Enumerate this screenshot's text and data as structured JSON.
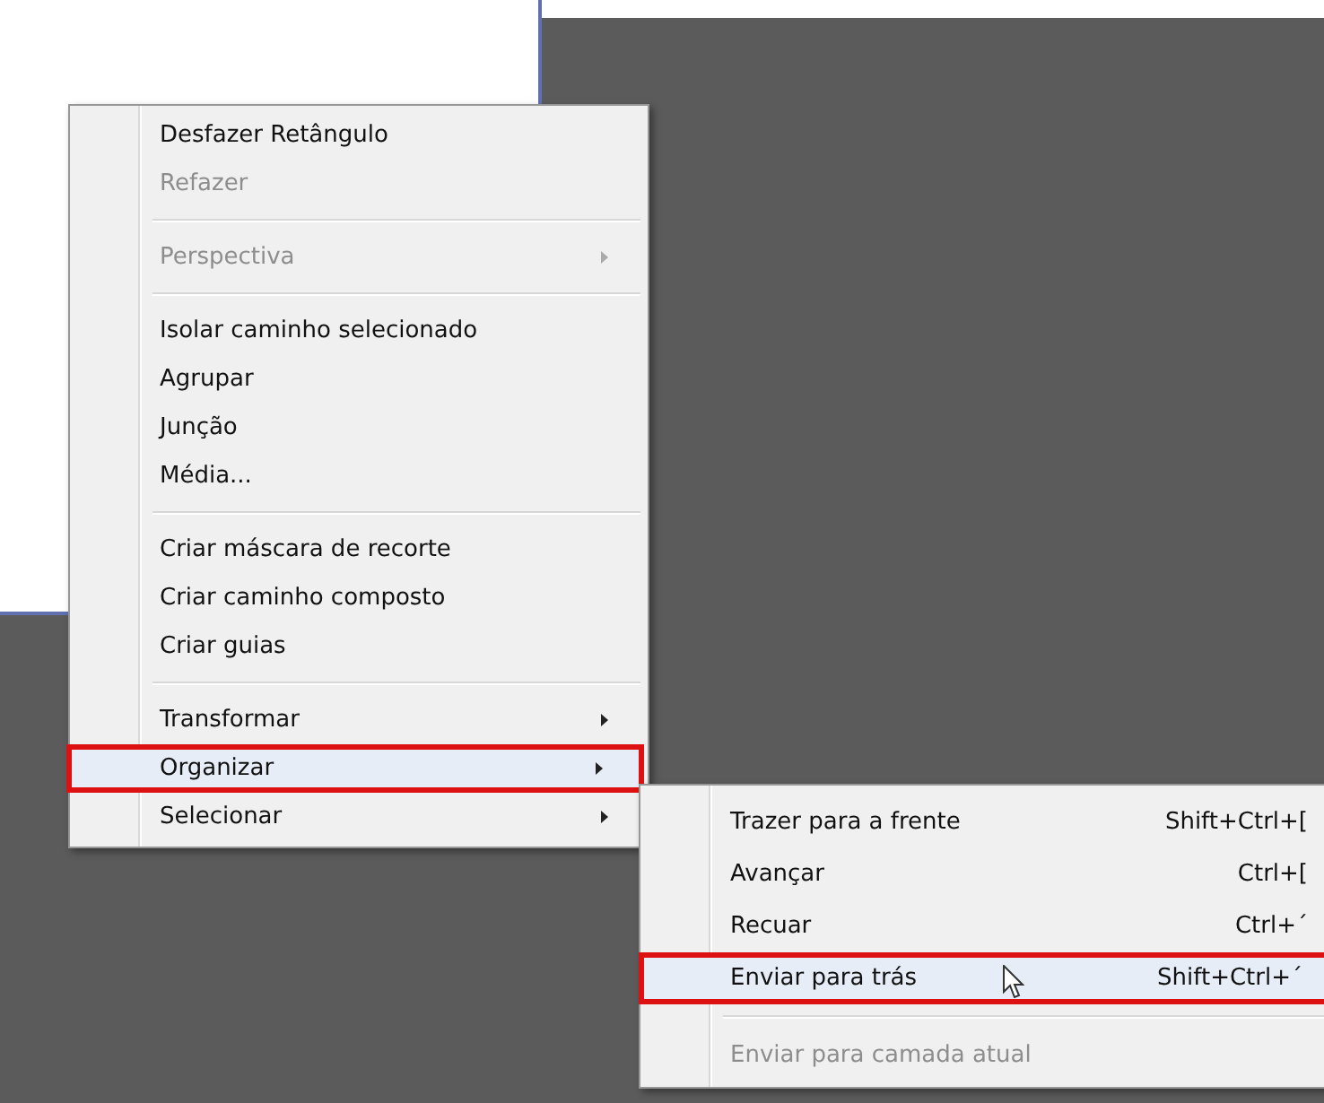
{
  "context_menu": {
    "items": [
      {
        "kind": "item",
        "label": "Desfazer Retângulo",
        "disabled": false,
        "submenu": false,
        "highlighted": false
      },
      {
        "kind": "item",
        "label": "Refazer",
        "disabled": true,
        "submenu": false,
        "highlighted": false
      },
      {
        "kind": "separator"
      },
      {
        "kind": "item",
        "label": "Perspectiva",
        "disabled": true,
        "submenu": true,
        "highlighted": false
      },
      {
        "kind": "separator"
      },
      {
        "kind": "item",
        "label": "Isolar caminho selecionado",
        "disabled": false,
        "submenu": false,
        "highlighted": false
      },
      {
        "kind": "item",
        "label": "Agrupar",
        "disabled": false,
        "submenu": false,
        "highlighted": false
      },
      {
        "kind": "item",
        "label": "Junção",
        "disabled": false,
        "submenu": false,
        "highlighted": false
      },
      {
        "kind": "item",
        "label": "Média...",
        "disabled": false,
        "submenu": false,
        "highlighted": false
      },
      {
        "kind": "separator"
      },
      {
        "kind": "item",
        "label": "Criar máscara de recorte",
        "disabled": false,
        "submenu": false,
        "highlighted": false
      },
      {
        "kind": "item",
        "label": "Criar caminho composto",
        "disabled": false,
        "submenu": false,
        "highlighted": false
      },
      {
        "kind": "item",
        "label": "Criar guias",
        "disabled": false,
        "submenu": false,
        "highlighted": false
      },
      {
        "kind": "separator"
      },
      {
        "kind": "item",
        "label": "Transformar",
        "disabled": false,
        "submenu": true,
        "highlighted": false
      },
      {
        "kind": "item",
        "label": "Organizar",
        "disabled": false,
        "submenu": true,
        "highlighted": true
      },
      {
        "kind": "item",
        "label": "Selecionar",
        "disabled": false,
        "submenu": true,
        "highlighted": false
      }
    ]
  },
  "submenu": {
    "items": [
      {
        "kind": "item",
        "label": "Trazer para a frente",
        "shortcut": "Shift+Ctrl+[",
        "disabled": false,
        "highlighted": false
      },
      {
        "kind": "item",
        "label": "Avançar",
        "shortcut": "Ctrl+[",
        "disabled": false,
        "highlighted": false
      },
      {
        "kind": "item",
        "label": "Recuar",
        "shortcut": "Ctrl+´",
        "disabled": false,
        "highlighted": false
      },
      {
        "kind": "item",
        "label": "Enviar para trás",
        "shortcut": "Shift+Ctrl+´",
        "disabled": false,
        "highlighted": true
      },
      {
        "kind": "separator"
      },
      {
        "kind": "item",
        "label": "Enviar para camada atual",
        "disabled": true,
        "highlighted": false
      }
    ]
  }
}
